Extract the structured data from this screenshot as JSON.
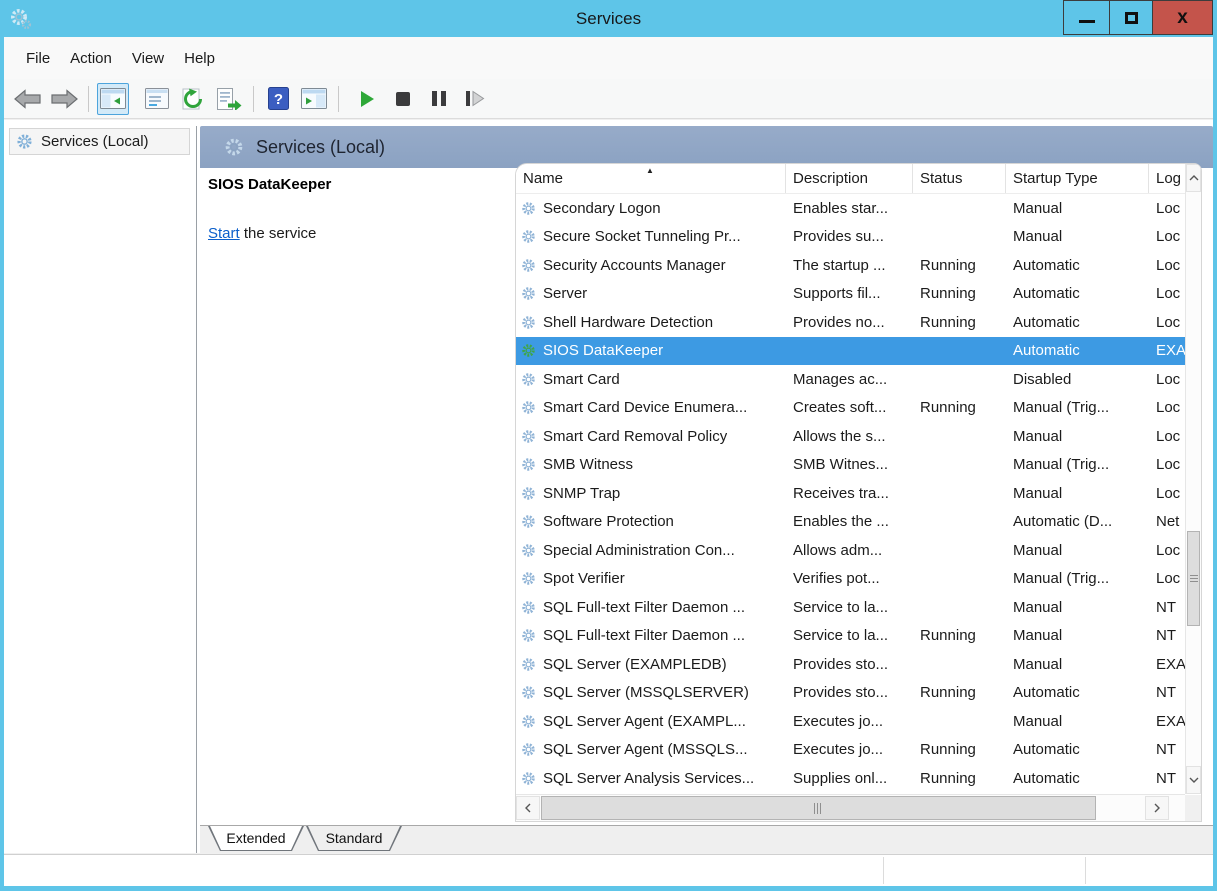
{
  "window": {
    "title": "Services",
    "controls": {
      "close_glyph": "x"
    }
  },
  "menu": {
    "items": [
      "File",
      "Action",
      "View",
      "Help"
    ]
  },
  "toolbar": {
    "buttons": [
      "back",
      "forward",
      "show-hide-console-tree",
      "properties",
      "refresh",
      "export-list",
      "help",
      "show-hide-action-pane",
      "start-service",
      "stop-service",
      "pause-service",
      "restart-service"
    ]
  },
  "sidebar": {
    "root_label": "Services (Local)"
  },
  "main": {
    "pane_title": "Services (Local)",
    "selected_service_name": "SIOS DataKeeper",
    "service_action": {
      "link": "Start",
      "suffix": " the service"
    },
    "table": {
      "columns": [
        "Name",
        "Description",
        "Status",
        "Startup Type",
        "Log"
      ],
      "sort_column": "Name",
      "sort_direction": "ascending",
      "rows": [
        {
          "name": "Secondary Logon",
          "description": "Enables star...",
          "status": "",
          "startup_type": "Manual",
          "log_on_as": "Loc",
          "selected": false
        },
        {
          "name": "Secure Socket Tunneling Pr...",
          "description": "Provides su...",
          "status": "",
          "startup_type": "Manual",
          "log_on_as": "Loc",
          "selected": false
        },
        {
          "name": "Security Accounts Manager",
          "description": "The startup ...",
          "status": "Running",
          "startup_type": "Automatic",
          "log_on_as": "Loc",
          "selected": false
        },
        {
          "name": "Server",
          "description": "Supports fil...",
          "status": "Running",
          "startup_type": "Automatic",
          "log_on_as": "Loc",
          "selected": false
        },
        {
          "name": "Shell Hardware Detection",
          "description": "Provides no...",
          "status": "Running",
          "startup_type": "Automatic",
          "log_on_as": "Loc",
          "selected": false
        },
        {
          "name": "SIOS DataKeeper",
          "description": "",
          "status": "",
          "startup_type": "Automatic",
          "log_on_as": "EXA",
          "selected": true
        },
        {
          "name": "Smart Card",
          "description": "Manages ac...",
          "status": "",
          "startup_type": "Disabled",
          "log_on_as": "Loc",
          "selected": false
        },
        {
          "name": "Smart Card Device Enumera...",
          "description": "Creates soft...",
          "status": "Running",
          "startup_type": "Manual (Trig...",
          "log_on_as": "Loc",
          "selected": false
        },
        {
          "name": "Smart Card Removal Policy",
          "description": "Allows the s...",
          "status": "",
          "startup_type": "Manual",
          "log_on_as": "Loc",
          "selected": false
        },
        {
          "name": "SMB Witness",
          "description": "SMB Witnes...",
          "status": "",
          "startup_type": "Manual (Trig...",
          "log_on_as": "Loc",
          "selected": false
        },
        {
          "name": "SNMP Trap",
          "description": "Receives tra...",
          "status": "",
          "startup_type": "Manual",
          "log_on_as": "Loc",
          "selected": false
        },
        {
          "name": "Software Protection",
          "description": "Enables the ...",
          "status": "",
          "startup_type": "Automatic (D...",
          "log_on_as": "Net",
          "selected": false
        },
        {
          "name": "Special Administration Con...",
          "description": "Allows adm...",
          "status": "",
          "startup_type": "Manual",
          "log_on_as": "Loc",
          "selected": false
        },
        {
          "name": "Spot Verifier",
          "description": "Verifies pot...",
          "status": "",
          "startup_type": "Manual (Trig...",
          "log_on_as": "Loc",
          "selected": false
        },
        {
          "name": "SQL Full-text Filter Daemon ...",
          "description": "Service to la...",
          "status": "",
          "startup_type": "Manual",
          "log_on_as": "NT",
          "selected": false
        },
        {
          "name": "SQL Full-text Filter Daemon ...",
          "description": "Service to la...",
          "status": "Running",
          "startup_type": "Manual",
          "log_on_as": "NT",
          "selected": false
        },
        {
          "name": "SQL Server (EXAMPLEDB)",
          "description": "Provides sto...",
          "status": "",
          "startup_type": "Manual",
          "log_on_as": "EXA",
          "selected": false
        },
        {
          "name": "SQL Server (MSSQLSERVER)",
          "description": "Provides sto...",
          "status": "Running",
          "startup_type": "Automatic",
          "log_on_as": "NT",
          "selected": false
        },
        {
          "name": "SQL Server Agent (EXAMPL...",
          "description": "Executes jo...",
          "status": "",
          "startup_type": "Manual",
          "log_on_as": "EXA",
          "selected": false
        },
        {
          "name": "SQL Server Agent (MSSQLS...",
          "description": "Executes jo...",
          "status": "Running",
          "startup_type": "Automatic",
          "log_on_as": "NT",
          "selected": false
        },
        {
          "name": "SQL Server Analysis Services...",
          "description": "Supplies onl...",
          "status": "Running",
          "startup_type": "Automatic",
          "log_on_as": "NT",
          "selected": false
        }
      ]
    },
    "tabs": [
      {
        "label": "Extended",
        "active": true
      },
      {
        "label": "Standard",
        "active": false
      }
    ]
  },
  "colors": {
    "titlebar": "#5EC5E8",
    "close_button": "#C4544B",
    "selection": "#3D9AE3",
    "header_band": "#91A7C6",
    "link": "#0B5FCB"
  }
}
